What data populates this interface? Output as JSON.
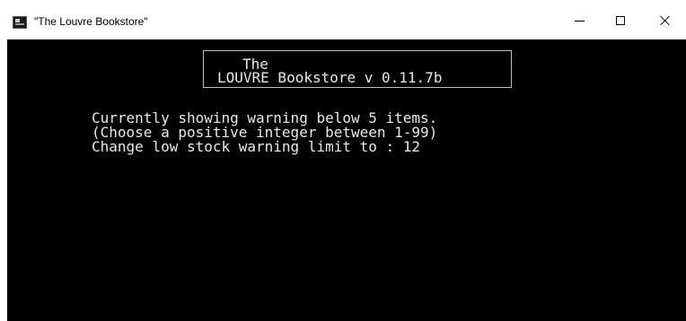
{
  "window": {
    "title": "\"The Louvre Bookstore\"",
    "icon": "console-app-icon",
    "controls": {
      "minimize": "minimize-icon",
      "maximize": "maximize-icon",
      "close": "close-icon"
    }
  },
  "console": {
    "background": "#000000",
    "text_color": "#e8e8e8",
    "banner": {
      "line1": "The",
      "line2": "LOUVRE Bookstore v 0.11.7b"
    },
    "lines": [
      "Currently showing warning below 5 items.",
      "(Choose a positive integer between 1-99)",
      "Change low stock warning limit to : 12"
    ]
  }
}
